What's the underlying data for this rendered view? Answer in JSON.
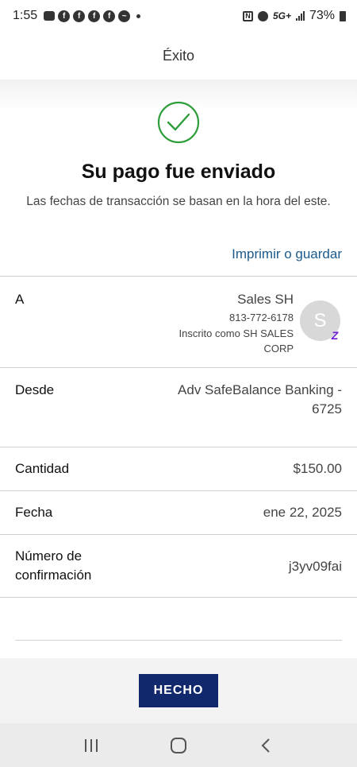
{
  "status_bar": {
    "time": "1:55",
    "battery": "73%",
    "network": "5G+"
  },
  "header": {
    "title": "Éxito"
  },
  "confirmation": {
    "title": "Su pago fue enviado",
    "subtitle": "Las fechas de transacción se basan en la hora del este.",
    "print_link": "Imprimir o guardar"
  },
  "details": {
    "to": {
      "label": "A",
      "name": "Sales SH",
      "phone": "813-772-6178",
      "enrolled_line1": "Inscrito como SH SALES",
      "enrolled_line2": "CORP",
      "avatar_initial": "S",
      "badge": "Z"
    },
    "from": {
      "label": "Desde",
      "line1": "Adv SafeBalance Banking -",
      "line2": "6725"
    },
    "amount": {
      "label": "Cantidad",
      "value": "$150.00"
    },
    "date": {
      "label": "Fecha",
      "value": "ene 22, 2025"
    },
    "confirmation": {
      "label_line1": "Número de",
      "label_line2": "confirmación",
      "value": "j3yv09fai"
    }
  },
  "footer": {
    "done_label": "HECHO"
  },
  "colors": {
    "success_green": "#2e9e3a",
    "link_blue": "#1b5a8c",
    "button_navy": "#12286d",
    "zelle_purple": "#6d1ed4"
  },
  "icons": [
    "message-icon",
    "facebook-icon",
    "messenger-icon",
    "nfc-icon",
    "alarm-icon",
    "signal-icon",
    "battery-icon",
    "check-circle-icon",
    "zelle-icon",
    "recent-apps-icon",
    "home-icon",
    "back-icon"
  ]
}
